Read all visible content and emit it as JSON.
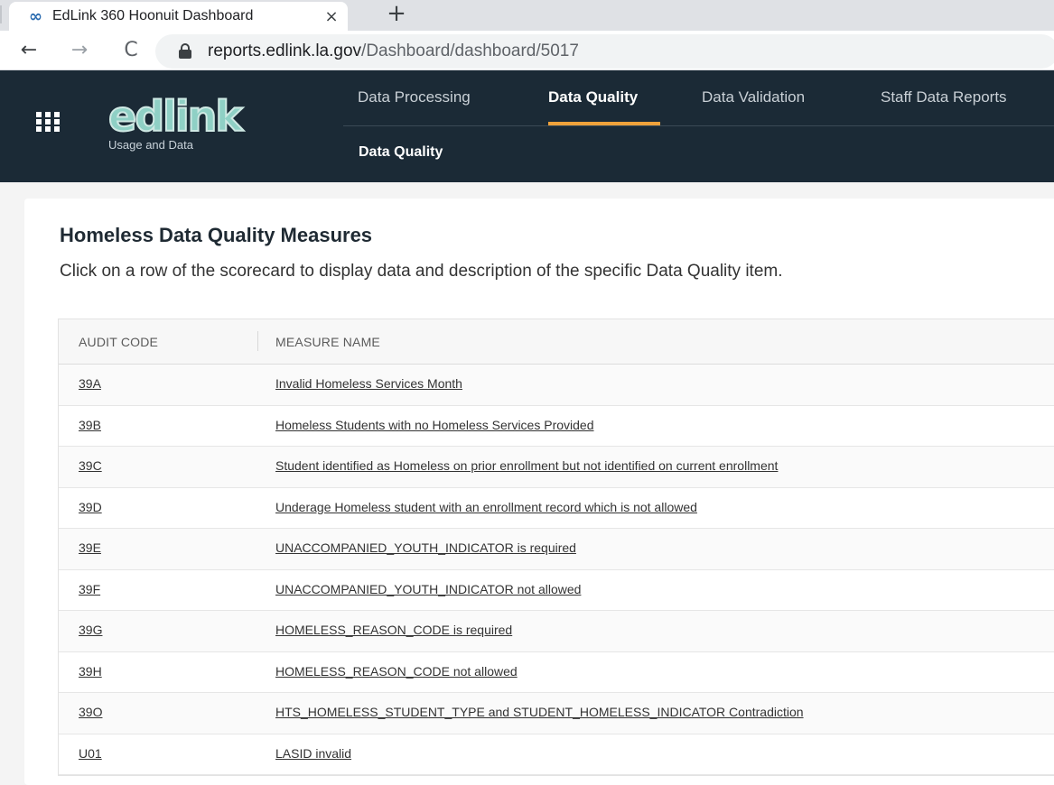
{
  "browser": {
    "tab_title": "EdLink 360 Hoonuit Dashboard",
    "tab_close": "×",
    "new_tab": "+",
    "url_host": "reports.edlink.la.gov",
    "url_path": "/Dashboard/dashboard/5017",
    "back": "←",
    "forward": "→",
    "reload": "C"
  },
  "header": {
    "logo_text": "edlink",
    "logo_sub": "Usage and Data",
    "nav": [
      {
        "label": "Data Processing"
      },
      {
        "label": "Data Quality"
      },
      {
        "label": "Data Validation"
      },
      {
        "label": "Staff Data Reports"
      }
    ],
    "active_nav": "Data Quality",
    "subnav": "Data Quality"
  },
  "main": {
    "title": "Homeless Data Quality Measures",
    "description": "Click on a row of the scorecard to display data and description of the specific Data Quality item.",
    "table": {
      "columns": [
        "AUDIT CODE",
        "MEASURE NAME"
      ],
      "rows": [
        {
          "code": "39A",
          "name": "Invalid Homeless Services Month"
        },
        {
          "code": "39B",
          "name": "Homeless Students with no Homeless Services Provided"
        },
        {
          "code": "39C",
          "name": "Student identified as Homeless on prior enrollment but not identified on current enrollment"
        },
        {
          "code": "39D",
          "name": "Underage Homeless student with an enrollment record which is not allowed"
        },
        {
          "code": "39E",
          "name": "UNACCOMPANIED_YOUTH_INDICATOR is required"
        },
        {
          "code": "39F",
          "name": "UNACCOMPANIED_YOUTH_INDICATOR not allowed"
        },
        {
          "code": "39G",
          "name": "HOMELESS_REASON_CODE is required"
        },
        {
          "code": "39H",
          "name": "HOMELESS_REASON_CODE not allowed"
        },
        {
          "code": "39O",
          "name": "HTS_HOMELESS_STUDENT_TYPE and STUDENT_HOMELESS_INDICATOR Contradiction"
        },
        {
          "code": "U01",
          "name": "LASID invalid"
        }
      ]
    }
  },
  "colors": {
    "header_bg": "#1b2a36",
    "accent": "#f0a23b",
    "logo": "#8fd0c5"
  }
}
